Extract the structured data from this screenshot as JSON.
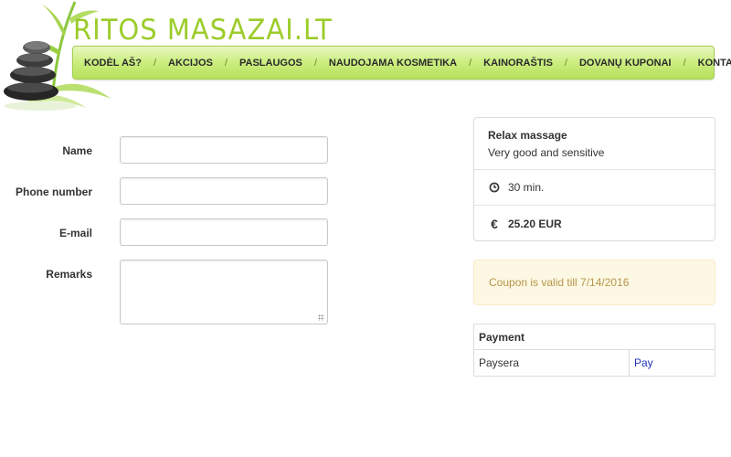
{
  "header": {
    "brand": "RITOS MASAZAI.LT",
    "nav": [
      "KODĖL AŠ?",
      "AKCIJOS",
      "PASLAUGOS",
      "NAUDOJAMA KOSMETIKA",
      "KAINORAŠTIS",
      "DOVANŲ KUPONAI",
      "KONTAKTAI"
    ],
    "nav_separator": "/"
  },
  "form": {
    "name_label": "Name",
    "name_value": "",
    "phone_label": "Phone number",
    "phone_value": "",
    "email_label": "E-mail",
    "email_value": "",
    "remarks_label": "Remarks",
    "remarks_value": ""
  },
  "service": {
    "title": "Relax massage",
    "description": "Very good and sensitive",
    "duration": "30 min.",
    "price": "25.20 EUR",
    "currency_symbol": "€",
    "duration_icon": "clock-icon",
    "price_icon": "euro-icon"
  },
  "coupon": {
    "message": "Coupon is valid till 7/14/2016"
  },
  "payment": {
    "header": "Payment",
    "method": "Paysera",
    "action": "Pay"
  },
  "colors": {
    "brand_green": "#9ccc2a",
    "nav_green": "#cdef84",
    "alert_bg": "#fcf8e3",
    "alert_text": "#b8954c",
    "link_blue": "#2233bb"
  }
}
